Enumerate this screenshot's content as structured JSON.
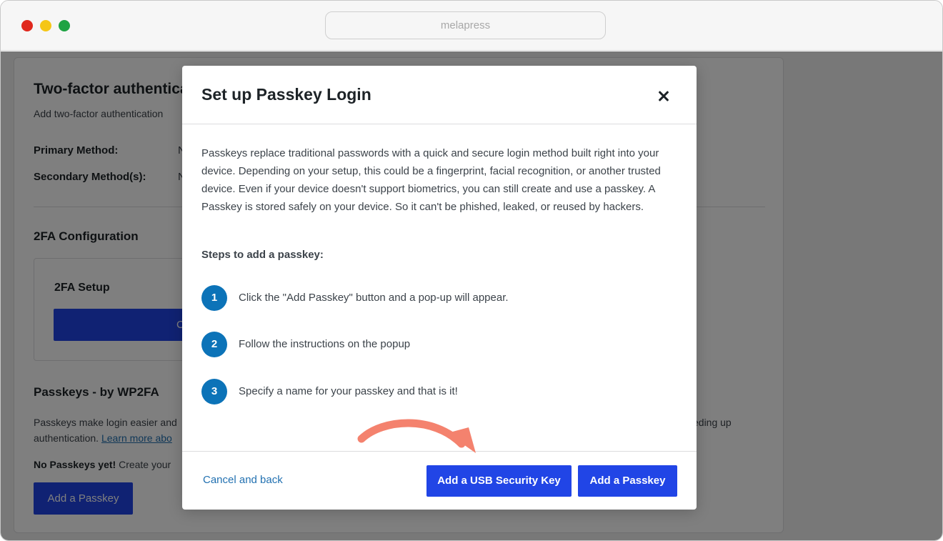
{
  "browser": {
    "address": "melapress"
  },
  "background": {
    "title": "Two-factor authentication",
    "subtitle": "Add two-factor authentication",
    "primary_label": "Primary Method:",
    "primary_value": "N",
    "secondary_label": "Secondary Method(s):",
    "secondary_value": "N",
    "config_title": "2FA Configuration",
    "setup_title": "2FA Setup",
    "setup_button": "C",
    "passkeys_title": "Passkeys - by WP2FA",
    "passkeys_desc_1": "Passkeys make login easier and",
    "passkeys_desc_right": "eding up",
    "passkeys_desc_2": "authentication.",
    "learn_more": "Learn more abo",
    "no_passkeys_bold": "No Passkeys yet!",
    "no_passkeys_text": " Create your",
    "add_button": "Add a Passkey"
  },
  "modal": {
    "title": "Set up Passkey Login",
    "intro": "Passkeys replace traditional passwords with a quick and secure login method built right into your device. Depending on your setup, this could be a fingerprint, facial recognition, or another trusted device. Even if your device doesn't support biometrics, you can still create and use a passkey. A Passkey is stored safely on your device. So it can't be phished, leaked, or reused by hackers.",
    "steps_title": "Steps to add a passkey:",
    "steps": [
      {
        "num": "1",
        "text": "Click the \"Add Passkey\" button and a pop-up will appear."
      },
      {
        "num": "2",
        "text": "Follow the instructions on the popup"
      },
      {
        "num": "3",
        "text": "Specify a name for your passkey and that is it!"
      }
    ],
    "cancel": "Cancel and back",
    "usb_button": "Add a USB Security Key",
    "passkey_button": "Add a Passkey"
  },
  "colors": {
    "primary": "#2145e6",
    "step": "#0c73b8",
    "link": "#2271b1",
    "annotation_arrow": "#f4826e"
  }
}
